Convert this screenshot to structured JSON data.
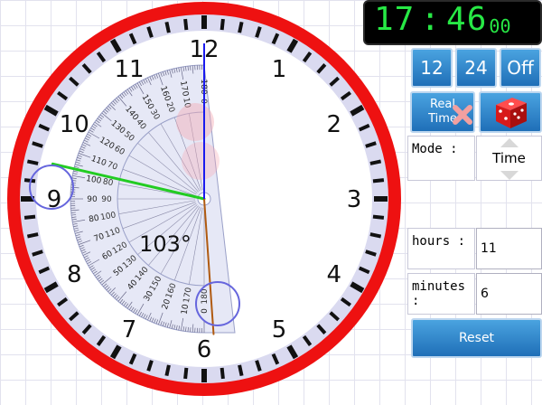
{
  "clock": {
    "numerals": [
      "12",
      "1",
      "2",
      "3",
      "4",
      "5",
      "6",
      "7",
      "8",
      "9",
      "10",
      "11"
    ],
    "hour_hand_angle_deg": 283,
    "minute_hand_angle_deg": 176,
    "second_hand_angle_deg": 0,
    "colors": {
      "rim": "#ee1111",
      "hour_hand": "#22cc22",
      "minute_hand": "#b05a10",
      "second_hand": "#1a1aee",
      "handle_circle": "#6666dd"
    }
  },
  "protractor": {
    "angle_readout": "103°",
    "outer_scale_labels": [
      "180",
      "170",
      "160",
      "150",
      "140",
      "130",
      "120",
      "110",
      "100",
      "90",
      "80",
      "70",
      "60",
      "50",
      "40",
      "30",
      "20",
      "10",
      "0"
    ],
    "inner_scale_labels": [
      "0",
      "10",
      "20",
      "30",
      "40",
      "50",
      "60",
      "70",
      "80",
      "90",
      "100",
      "110",
      "120",
      "130",
      "140",
      "150",
      "160",
      "170",
      "180"
    ]
  },
  "digital_display": {
    "hours": "17",
    "minutes": "46",
    "seconds": "00",
    "colon": ":"
  },
  "controls": {
    "format_12_label": "12",
    "format_24_label": "24",
    "format_off_label": "Off",
    "realtime_label_line1": "Real",
    "realtime_label_line2": "Time",
    "mode_label": "Mode :",
    "mode_value": "Time",
    "hours_label": "hours :",
    "hours_value": "11",
    "minutes_label": "minutes :",
    "minutes_value": "6",
    "reset_label": "Reset"
  },
  "icons": {
    "realtime_overlay": "x-mark-icon",
    "random": "dice-icon",
    "mode_up": "triangle-up-icon",
    "mode_down": "triangle-down-icon"
  }
}
